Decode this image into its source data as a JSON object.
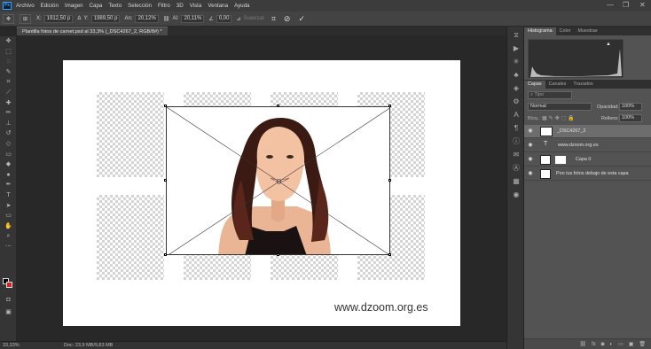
{
  "app": {
    "logo": "Ps",
    "window_controls": {
      "minimize": "—",
      "maximize": "❐",
      "close": "✕"
    }
  },
  "menu": [
    "Archivo",
    "Edición",
    "Imagen",
    "Capa",
    "Texto",
    "Selección",
    "Filtro",
    "3D",
    "Vista",
    "Ventana",
    "Ayuda"
  ],
  "options": {
    "x_label": "X:",
    "x_value": "1912,50 p",
    "y_label": "Y:",
    "y_value": "1989,50 p",
    "w_label": "An:",
    "w_value": "20,12%",
    "h_label": "Al:",
    "h_value": "20,11%",
    "angle_value": "0,00",
    "interp_label": "Suavizar",
    "cancel_icon": "⊘",
    "commit_icon": "✓"
  },
  "document_tab": "Plantilla fotos de carnet.psd al 33,3% (_DSC4267_2, RGB/8#) *",
  "canvas": {
    "watermark": "www.dzoom.org.es"
  },
  "status": {
    "zoom": "33,33%",
    "doc": "Doc: 23,9 MB/9,83 MB"
  },
  "panels": {
    "top_tabs": [
      "Histograma",
      "Color",
      "Muestras"
    ],
    "layers_tabs": [
      "Capas",
      "Canales",
      "Trazados"
    ],
    "filter_placeholder": "Tipo",
    "blend_mode": "Normal",
    "opacity_label": "Opacidad:",
    "opacity_value": "100%",
    "lock_label": "Bloq.:",
    "fill_label": "Relleno:",
    "fill_value": "100%",
    "layers": [
      {
        "name": "_DSC4267_2"
      },
      {
        "name": "www.dzoom.org.es"
      },
      {
        "name": "Capa 0"
      },
      {
        "name": "Pon tus fotos debajo de esta capa"
      }
    ]
  },
  "colors": {
    "accent": "#31a8ff",
    "foreground": "#000000",
    "background": "#e02020"
  }
}
